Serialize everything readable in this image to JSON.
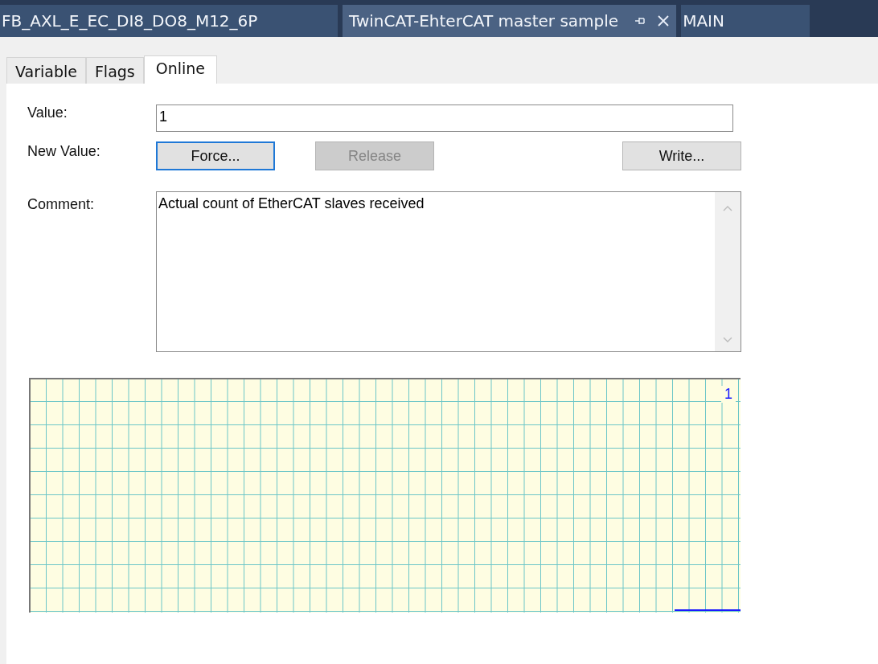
{
  "document_tabs": [
    {
      "label": "FB_AXL_E_EC_DI8_DO8_M12_6P",
      "selected": false
    },
    {
      "label": "TwinCAT-EhterCAT master sample",
      "selected": true
    },
    {
      "label": "MAIN",
      "selected": false
    }
  ],
  "property_tabs": [
    {
      "label": "Variable",
      "selected": false
    },
    {
      "label": "Flags",
      "selected": false
    },
    {
      "label": "Online",
      "selected": true
    }
  ],
  "value": {
    "label": "Value:",
    "value": "1"
  },
  "new_value": {
    "label": "New Value:",
    "buttons": [
      {
        "label": "Force...",
        "focused": true,
        "disabled": false
      },
      {
        "label": "Release",
        "focused": false,
        "disabled": true
      },
      {
        "label": "Write...",
        "focused": false,
        "disabled": false
      }
    ]
  },
  "comment": {
    "label": "Comment:",
    "value": "Actual count of EtherCAT slaves received"
  },
  "trend": {
    "scale_label": "1"
  }
}
